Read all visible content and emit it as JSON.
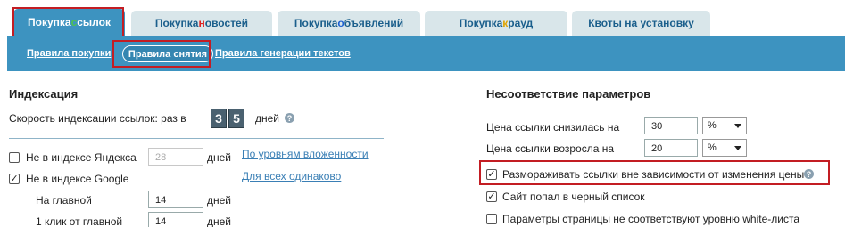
{
  "tabs": [
    {
      "label_parts": [
        "Покупка ",
        "с",
        "сылок"
      ],
      "active": true
    },
    {
      "label_parts": [
        "Покупка ",
        "н",
        "овостей"
      ],
      "active": false
    },
    {
      "label_parts": [
        "Покупка ",
        "о",
        "бъявлений"
      ],
      "active": false
    },
    {
      "label_parts": [
        "Покупка ",
        "к",
        "рауд"
      ],
      "active": false
    },
    {
      "label": "Квоты на установку",
      "active": false
    }
  ],
  "accent_letter_colors": [
    "#2d8a2d",
    "#d22",
    "#1b5fd1",
    "#e0a400"
  ],
  "subnav": {
    "buy_rules": "Правила покупки",
    "remove_rules": "Правила снятия",
    "gen_rules": "Правила генерации текстов"
  },
  "indexing": {
    "title": "Индексация",
    "speed_label": "Скорость индексации ссылок: раз в",
    "speed_digits": [
      "3",
      "5"
    ],
    "speed_unit": "дней",
    "not_yandex_label": "Не в индексе Яндекса",
    "not_yandex_checked": false,
    "not_yandex_value": "28",
    "not_yandex_unit": "дней",
    "not_google_label": "Не в индексе Google",
    "not_google_checked": true,
    "by_levels_link": "По уровням вложенности",
    "all_same_link": "Для всех одинаково",
    "main_label": "На главной",
    "main_value": "14",
    "main_unit": "дней",
    "one_click_label": "1 клик от главной",
    "one_click_value": "14",
    "one_click_unit": "дней"
  },
  "mismatch": {
    "title": "Несоответствие параметров",
    "price_down_label": "Цена ссылки снизилась на",
    "price_down_value": "30",
    "price_down_unit": "%",
    "price_up_label": "Цена ссылки возросла на",
    "price_up_value": "20",
    "price_up_unit": "%",
    "unfreeze_label": "Размораживать ссылки вне зависимости от изменения цены",
    "unfreeze_checked": true,
    "blacklist_label": "Сайт попал в черный список",
    "blacklist_checked": true,
    "whitelist_label": "Параметры страницы не соответствуют уровню white-листа",
    "whitelist_checked": false
  }
}
